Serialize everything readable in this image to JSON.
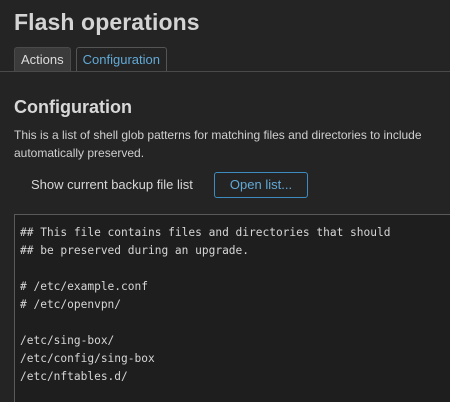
{
  "page": {
    "title": "Flash operations"
  },
  "tabs": [
    {
      "label": "Actions",
      "active": false
    },
    {
      "label": "Configuration",
      "active": true
    }
  ],
  "section": {
    "title": "Configuration",
    "description_line1": "This is a list of shell glob patterns for matching files and directories to include",
    "description_line2": "automatically preserved."
  },
  "backup": {
    "label": "Show current backup file list",
    "button_label": "Open list..."
  },
  "editor": {
    "lines": [
      "## This file contains files and directories that should",
      "## be preserved during an upgrade.",
      "",
      "# /etc/example.conf",
      "# /etc/openvpn/",
      "",
      "/etc/sing-box/",
      "/etc/config/sing-box",
      "/etc/nftables.d/",
      ""
    ]
  },
  "colors": {
    "background": "#242424",
    "accent": "#62a9d6",
    "text": "#d6d6d6"
  }
}
